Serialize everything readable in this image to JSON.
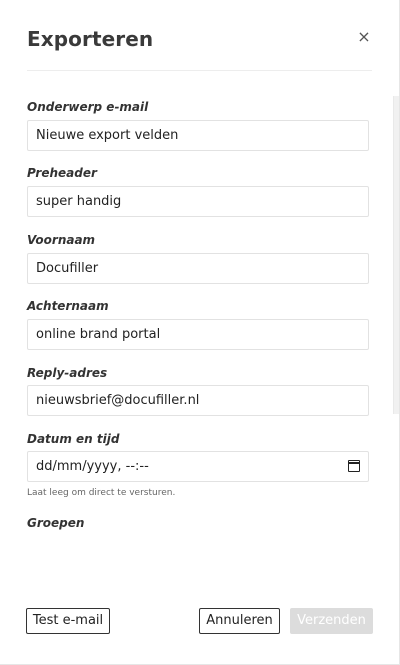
{
  "modal": {
    "title": "Exporteren",
    "close_glyph": "×"
  },
  "form": {
    "subject": {
      "label": "Onderwerp e-mail",
      "value": "Nieuwe export velden"
    },
    "preheader": {
      "label": "Preheader",
      "value": "super handig"
    },
    "firstname": {
      "label": "Voornaam",
      "value": "Docufiller"
    },
    "lastname": {
      "label": "Achternaam",
      "value": "online brand portal"
    },
    "reply": {
      "label": "Reply-adres",
      "value": "nieuwsbrief@docufiller.nl"
    },
    "datetime": {
      "label": "Datum en tijd",
      "value": "dd/mm/yyyy, --:--",
      "hint": "Laat leeg om direct te versturen."
    },
    "groups": {
      "label": "Groepen"
    }
  },
  "footer": {
    "test_label": "Test e-mail",
    "cancel_label": "Annuleren",
    "send_label": "Verzenden"
  },
  "icons": {
    "close": "close-icon",
    "calendar": "calendar-icon"
  }
}
